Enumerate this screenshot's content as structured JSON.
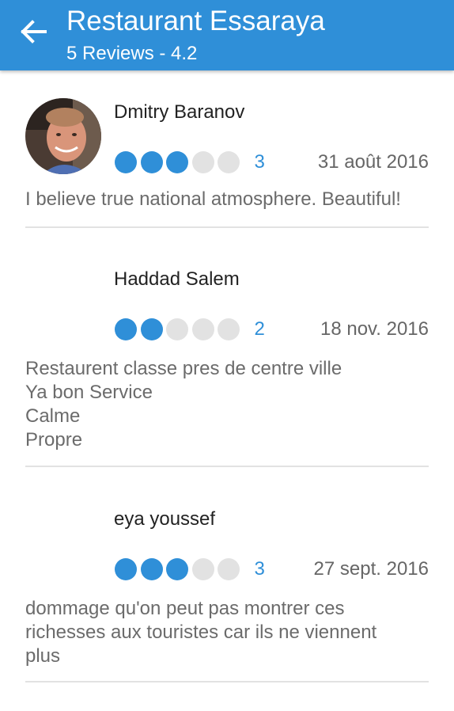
{
  "header": {
    "title": "Restaurant Essaraya",
    "subtitle": "5 Reviews - 4.2",
    "back_icon": "arrow-back-icon",
    "color": "#2f8fd8"
  },
  "reviews": [
    {
      "author": "Dmitry Baranov",
      "rating": 3,
      "rating_label": "3",
      "max_rating": 5,
      "date": "31 août 2016",
      "text_lines": [
        "I believe true national atmosphere. Beautiful!"
      ],
      "has_avatar": true
    },
    {
      "author": "Haddad Salem",
      "rating": 2,
      "rating_label": "2",
      "max_rating": 5,
      "date": "18 nov. 2016",
      "text_lines": [
        "Restaurent classe pres de centre ville",
        "Ya bon Service",
        "Calme",
        "Propre"
      ],
      "has_avatar": false
    },
    {
      "author": "eya youssef",
      "rating": 3,
      "rating_label": "3",
      "max_rating": 5,
      "date": "27 sept. 2016",
      "text_lines": [
        "dommage qu'on peut pas montrer ces",
        "richesses aux touristes car ils ne viennent",
        "plus"
      ],
      "has_avatar": false
    }
  ]
}
